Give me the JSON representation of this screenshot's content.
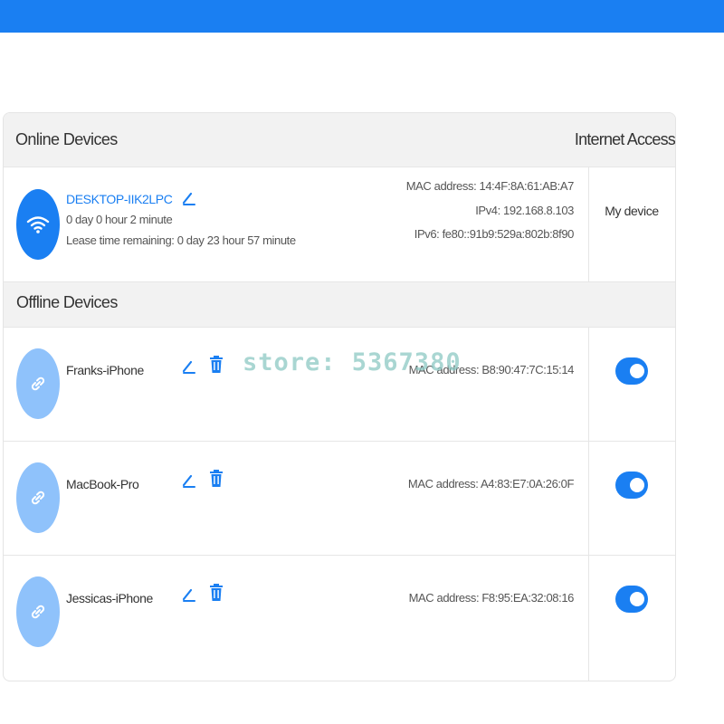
{
  "online_section": {
    "title": "Online Devices",
    "access_header": "Internet Access",
    "devices": [
      {
        "name": "DESKTOP-IIK2LPC",
        "uptime": "0 day 0 hour 2 minute",
        "lease": "Lease time remaining: 0 day 23 hour 57 minute",
        "mac": "MAC address: 14:4F:8A:61:AB:A7",
        "ipv4": "IPv4: 192.168.8.103",
        "ipv6": "IPv6: fe80::91b9:529a:802b:8f90",
        "access_label": "My device",
        "icon": "wifi-icon"
      }
    ]
  },
  "offline_section": {
    "title": "Offline Devices",
    "devices": [
      {
        "name": "Franks-iPhone",
        "mac": "MAC address: B8:90:47:7C:15:14",
        "access_enabled": true,
        "icon": "link-icon"
      },
      {
        "name": "MacBook-Pro",
        "mac": "MAC address: A4:83:E7:0A:26:0F",
        "access_enabled": true,
        "icon": "link-icon"
      },
      {
        "name": "Jessicas-iPhone",
        "mac": "MAC address: F8:95:EA:32:08:16",
        "access_enabled": true,
        "icon": "link-icon"
      }
    ]
  },
  "watermark": "store: 5367380",
  "colors": {
    "accent": "#1a7ff2",
    "offline_avatar": "#8fc2fb",
    "header_bg": "#f2f2f2"
  }
}
